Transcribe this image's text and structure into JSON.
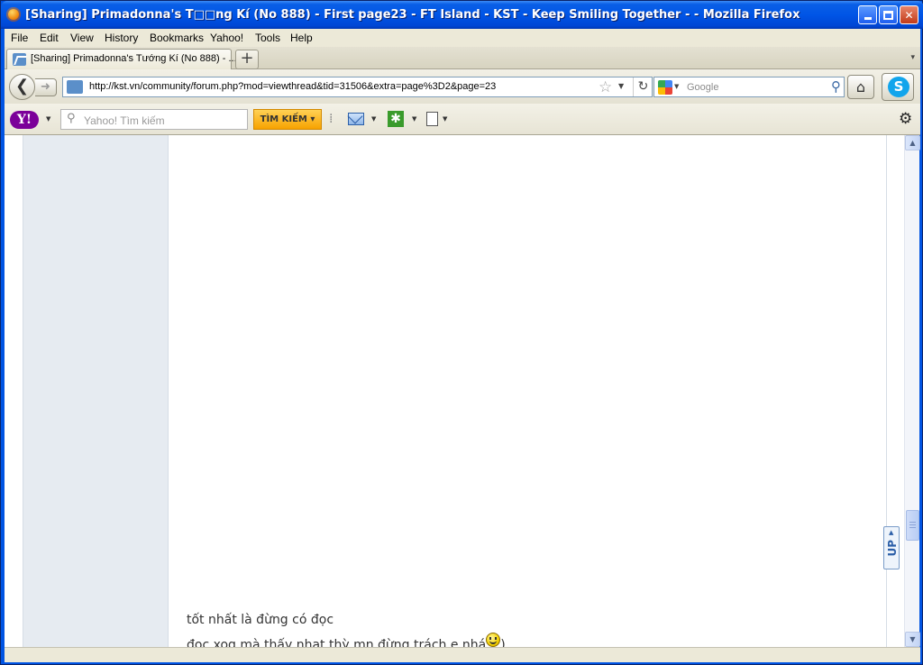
{
  "window": {
    "title": "[Sharing] Primadonna's T□□ng Kí (No 888) - First page23 - FT Island - KST - Keep Smiling Together - - Mozilla Firefox"
  },
  "menu": {
    "items": [
      "File",
      "Edit",
      "View",
      "History",
      "Bookmarks",
      "Yahoo!",
      "Tools",
      "Help"
    ]
  },
  "tabs": [
    {
      "label": "[Sharing] Primadonna's Tướng Kí (No 888) - ..."
    }
  ],
  "newtab_label": "+",
  "nav": {
    "url": "http://kst.vn/community/forum.php?mod=viewthread&tid=31506&extra=page%3D2&page=23",
    "search_placeholder": "Google"
  },
  "yahoo_toolbar": {
    "logo": "Y!",
    "search_placeholder": "Yahoo! Tìm kiếm",
    "search_button": "TÌM KIẾM ▾"
  },
  "post": {
    "line1": "tốt nhất là đừng có đọc",
    "line2": "đọc xog mà thấy nhạt thỳ mn đừng trách e nhá",
    "line2_end": ")"
  },
  "up_button": "UP",
  "icons": {
    "back": "back-arrow-icon",
    "forward": "forward-arrow-icon",
    "reload": "reload-icon",
    "home": "home-icon",
    "bookmark": "star-icon",
    "search": "magnifier-icon",
    "settings": "gear-icon",
    "skype": "skype-icon",
    "mail": "mail-icon"
  },
  "colors": {
    "titlebar": "#0055e6",
    "sidebar_column": "#e6ebf1",
    "yahoo_purple": "#7b0099",
    "yahoo_button": "#f7a200"
  }
}
